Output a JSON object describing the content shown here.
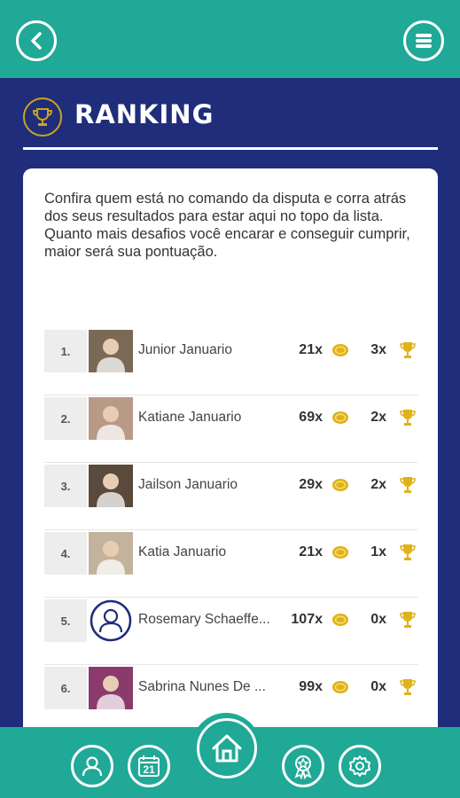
{
  "header": {
    "title": "RANKING"
  },
  "intro_text": "Confira quem está no comando da disputa e corra atrás dos seus resultados para estar aqui no topo da lista. Quanto mais desafios você encarar e conseguir cumprir, maior será sua pontuação.",
  "ranking": [
    {
      "position": "1.",
      "name": "Junior Januario",
      "coins": "21x",
      "trophies": "3x",
      "avatar": "photo"
    },
    {
      "position": "2.",
      "name": "Katiane Januario",
      "coins": "69x",
      "trophies": "2x",
      "avatar": "photo"
    },
    {
      "position": "3.",
      "name": "Jailson Januario",
      "coins": "29x",
      "trophies": "2x",
      "avatar": "photo"
    },
    {
      "position": "4.",
      "name": "Katia Januario",
      "coins": "21x",
      "trophies": "1x",
      "avatar": "photo"
    },
    {
      "position": "5.",
      "name": "Rosemary Schaeffe...",
      "coins": "107x",
      "trophies": "0x",
      "avatar": "user-placeholder"
    },
    {
      "position": "6.",
      "name": "Sabrina Nunes De ...",
      "coins": "99x",
      "trophies": "0x",
      "avatar": "photo"
    }
  ],
  "bottom_nav": {
    "calendar_day": "21",
    "items": [
      "profile-icon",
      "calendar-icon",
      "home-icon",
      "medal-icon",
      "settings-icon"
    ]
  },
  "colors": {
    "teal": "#1fa996",
    "navy": "#1f2d7a",
    "gold": "#e0b21a",
    "white": "#ffffff"
  }
}
